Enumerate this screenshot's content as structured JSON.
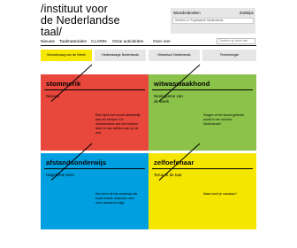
{
  "logo": {
    "line1": "/instituut voor",
    "line2": "de Nederlandse",
    "line3": "taal/"
  },
  "search": {
    "label_words": "Woordenboeken",
    "label_search": "Zoektips",
    "placeholder": "Zoeken in 'Fryslaanse Nederlands"
  },
  "nav": {
    "items": [
      "Nieuws",
      "Taalmaterialen",
      "CLARIN",
      "Onze activiteiten",
      "Over ons"
    ],
    "search_placeholder": "Zoeken op deze site"
  },
  "tabs": [
    {
      "label": "Woordvraag van de Week",
      "active": true
    },
    {
      "label": "Hedendaags Nederlands",
      "active": false
    },
    {
      "label": "Historisch Nederlands",
      "active": false
    },
    {
      "label": "Terminologie",
      "active": false
    }
  ],
  "tiles": [
    {
      "title": "stommerik",
      "subtitle": "Nieuws",
      "desc": "Elke tijd is het woord afhankelijk aan het nieuws? De medewerkers van het instituut doen er hun advies over op de rest",
      "color": "#e8473c"
    },
    {
      "title": "witwaswaakhond",
      "subtitle": "Neologisme van de week",
      "desc": "Vragen of het woord gebruikt wordt in het 'schone' Nederlands?",
      "color": "#8bc34a"
    },
    {
      "title": "afstandsonderwijs",
      "subtitle": "Uitgelichte term",
      "desc": "Een term uit het onderwijs die sinds enkele maanden veel meer aandacht krijgt",
      "color": "#00a0e0"
    },
    {
      "title": "zelfoefenaar",
      "subtitle": "Terug in de taal",
      "desc": "Waar komt je vandaan?",
      "color": "#f5e600"
    }
  ]
}
